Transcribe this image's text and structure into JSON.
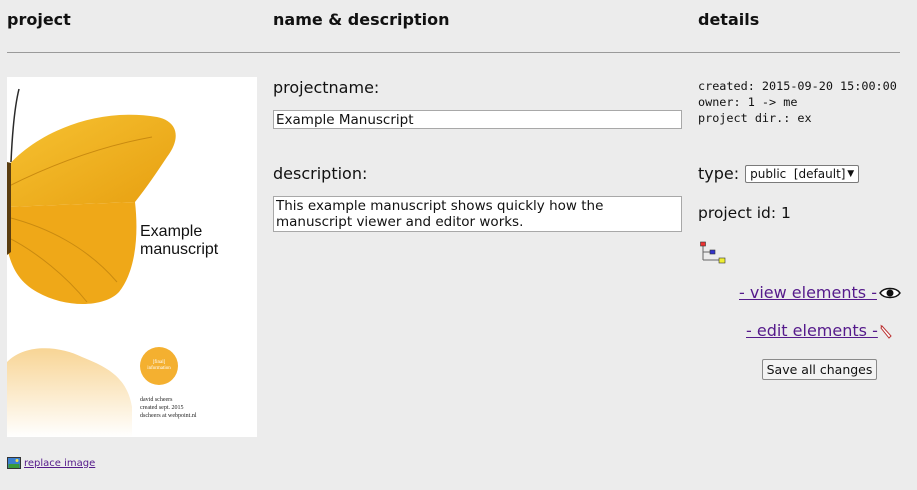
{
  "headers": {
    "project": "project",
    "name": "name & description",
    "details": "details"
  },
  "cover": {
    "title": "Example manuscript",
    "circle_text": "[final] information",
    "credits": [
      "david scheers",
      "created sept. 2015",
      "dscheers at webpoint.nl"
    ]
  },
  "replace_image": "replace image",
  "projectname": {
    "label": "projectname:",
    "value": "Example Manuscript"
  },
  "description": {
    "label": "description:",
    "value": "This example manuscript shows quickly how the manuscript viewer and editor works."
  },
  "details": {
    "created": "created: 2015-09-20 15:00:00",
    "owner": "owner: 1 -> me",
    "project_dir": "project dir.: ex",
    "type_label": "type:",
    "type_value": "public  [default]",
    "project_id": "project id: 1",
    "view_elements": "- view elements -",
    "edit_elements": "- edit elements -",
    "save_button": "Save all changes"
  },
  "colors": {
    "butterfly": "#f2b21b",
    "link": "#551a8b",
    "background": "#ececec"
  }
}
